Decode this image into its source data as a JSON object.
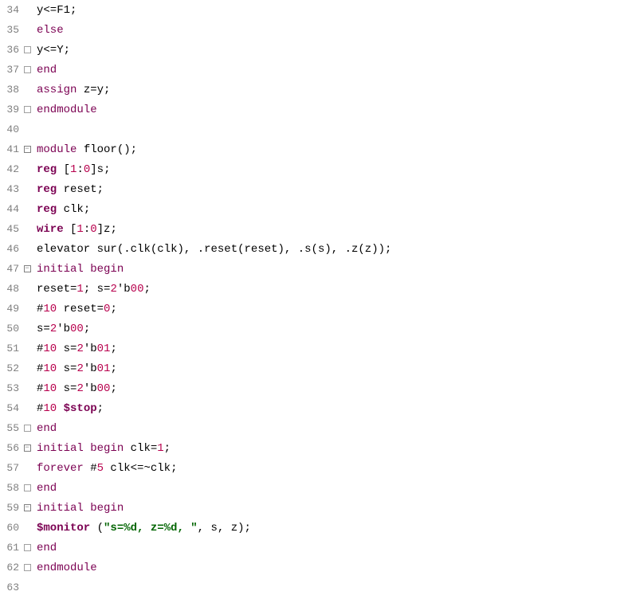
{
  "lines": [
    {
      "n": 34,
      "fold": "line",
      "tokens": [
        [
          "ident",
          "y"
        ],
        [
          "punct",
          "<="
        ],
        [
          "ident",
          "F1"
        ],
        [
          "punct",
          ";"
        ]
      ]
    },
    {
      "n": 35,
      "fold": "line",
      "tokens": [
        [
          "kw2",
          "else"
        ]
      ]
    },
    {
      "n": 36,
      "fold": "end",
      "tokens": [
        [
          "ident",
          "y"
        ],
        [
          "punct",
          "<="
        ],
        [
          "ident",
          "Y"
        ],
        [
          "punct",
          ";"
        ]
      ]
    },
    {
      "n": 37,
      "fold": "end",
      "tokens": [
        [
          "kw2",
          "end"
        ]
      ]
    },
    {
      "n": 38,
      "fold": "line",
      "tokens": [
        [
          "kw2",
          "assign"
        ],
        [
          "ident",
          " z"
        ],
        [
          "punct",
          "="
        ],
        [
          "ident",
          "y"
        ],
        [
          "punct",
          ";"
        ]
      ]
    },
    {
      "n": 39,
      "fold": "end",
      "tokens": [
        [
          "kw2",
          "endmodule"
        ]
      ]
    },
    {
      "n": 40,
      "fold": "line",
      "tokens": []
    },
    {
      "n": 41,
      "fold": "open",
      "tokens": [
        [
          "kw2",
          "module"
        ],
        [
          "ident",
          " floor"
        ],
        [
          "punct",
          "();"
        ]
      ]
    },
    {
      "n": 42,
      "fold": "line",
      "tokens": [
        [
          "kw",
          "reg"
        ],
        [
          "punct",
          " ["
        ],
        [
          "num",
          "1"
        ],
        [
          "punct",
          ":"
        ],
        [
          "num",
          "0"
        ],
        [
          "punct",
          "]"
        ],
        [
          "ident",
          "s"
        ],
        [
          "punct",
          ";"
        ]
      ]
    },
    {
      "n": 43,
      "fold": "line",
      "tokens": [
        [
          "kw",
          "reg"
        ],
        [
          "ident",
          " reset"
        ],
        [
          "punct",
          ";"
        ]
      ]
    },
    {
      "n": 44,
      "fold": "line",
      "tokens": [
        [
          "kw",
          "reg"
        ],
        [
          "ident",
          " clk"
        ],
        [
          "punct",
          ";"
        ]
      ]
    },
    {
      "n": 45,
      "fold": "line",
      "tokens": [
        [
          "kw",
          "wire"
        ],
        [
          "punct",
          " ["
        ],
        [
          "num",
          "1"
        ],
        [
          "punct",
          ":"
        ],
        [
          "num",
          "0"
        ],
        [
          "punct",
          "]"
        ],
        [
          "ident",
          "z"
        ],
        [
          "punct",
          ";"
        ]
      ]
    },
    {
      "n": 46,
      "fold": "line",
      "tokens": [
        [
          "ident",
          "elevator sur"
        ],
        [
          "punct",
          "(."
        ],
        [
          "ident",
          "clk"
        ],
        [
          "punct",
          "("
        ],
        [
          "ident",
          "clk"
        ],
        [
          "punct",
          "), ."
        ],
        [
          "ident",
          "reset"
        ],
        [
          "punct",
          "("
        ],
        [
          "ident",
          "reset"
        ],
        [
          "punct",
          "), ."
        ],
        [
          "ident",
          "s"
        ],
        [
          "punct",
          "("
        ],
        [
          "ident",
          "s"
        ],
        [
          "punct",
          "), ."
        ],
        [
          "ident",
          "z"
        ],
        [
          "punct",
          "("
        ],
        [
          "ident",
          "z"
        ],
        [
          "punct",
          "));"
        ]
      ]
    },
    {
      "n": 47,
      "fold": "open",
      "tokens": [
        [
          "kw2",
          "initial"
        ],
        [
          "ident",
          " "
        ],
        [
          "kw2",
          "begin"
        ]
      ]
    },
    {
      "n": 48,
      "fold": "line",
      "tokens": [
        [
          "ident",
          "reset"
        ],
        [
          "punct",
          "="
        ],
        [
          "num",
          "1"
        ],
        [
          "punct",
          "; "
        ],
        [
          "ident",
          "s"
        ],
        [
          "punct",
          "="
        ],
        [
          "num",
          "2"
        ],
        [
          "punct",
          "'b"
        ],
        [
          "num",
          "00"
        ],
        [
          "punct",
          ";"
        ]
      ]
    },
    {
      "n": 49,
      "fold": "line",
      "tokens": [
        [
          "punct",
          "#"
        ],
        [
          "num",
          "10"
        ],
        [
          "ident",
          " reset"
        ],
        [
          "punct",
          "="
        ],
        [
          "num",
          "0"
        ],
        [
          "punct",
          ";"
        ]
      ]
    },
    {
      "n": 50,
      "fold": "line",
      "tokens": [
        [
          "ident",
          "s"
        ],
        [
          "punct",
          "="
        ],
        [
          "num",
          "2"
        ],
        [
          "punct",
          "'b"
        ],
        [
          "num",
          "00"
        ],
        [
          "punct",
          ";"
        ]
      ]
    },
    {
      "n": 51,
      "fold": "line",
      "tokens": [
        [
          "punct",
          "#"
        ],
        [
          "num",
          "10"
        ],
        [
          "ident",
          " s"
        ],
        [
          "punct",
          "="
        ],
        [
          "num",
          "2"
        ],
        [
          "punct",
          "'b"
        ],
        [
          "num",
          "01"
        ],
        [
          "punct",
          ";"
        ]
      ]
    },
    {
      "n": 52,
      "fold": "line",
      "tokens": [
        [
          "punct",
          "#"
        ],
        [
          "num",
          "10"
        ],
        [
          "ident",
          " s"
        ],
        [
          "punct",
          "="
        ],
        [
          "num",
          "2"
        ],
        [
          "punct",
          "'b"
        ],
        [
          "num",
          "01"
        ],
        [
          "punct",
          ";"
        ]
      ]
    },
    {
      "n": 53,
      "fold": "line",
      "tokens": [
        [
          "punct",
          "#"
        ],
        [
          "num",
          "10"
        ],
        [
          "ident",
          " s"
        ],
        [
          "punct",
          "="
        ],
        [
          "num",
          "2"
        ],
        [
          "punct",
          "'b"
        ],
        [
          "num",
          "00"
        ],
        [
          "punct",
          ";"
        ]
      ]
    },
    {
      "n": 54,
      "fold": "line",
      "tokens": [
        [
          "punct",
          "#"
        ],
        [
          "num",
          "10"
        ],
        [
          "ident",
          " "
        ],
        [
          "sys",
          "$stop"
        ],
        [
          "punct",
          ";"
        ]
      ]
    },
    {
      "n": 55,
      "fold": "end",
      "tokens": [
        [
          "kw2",
          "end"
        ]
      ]
    },
    {
      "n": 56,
      "fold": "open",
      "tokens": [
        [
          "kw2",
          "initial"
        ],
        [
          "ident",
          " "
        ],
        [
          "kw2",
          "begin"
        ],
        [
          "ident",
          " clk"
        ],
        [
          "punct",
          "="
        ],
        [
          "num",
          "1"
        ],
        [
          "punct",
          ";"
        ]
      ]
    },
    {
      "n": 57,
      "fold": "line",
      "tokens": [
        [
          "kw2",
          "forever"
        ],
        [
          "punct",
          " #"
        ],
        [
          "num",
          "5"
        ],
        [
          "ident",
          " clk"
        ],
        [
          "punct",
          "<=~"
        ],
        [
          "ident",
          "clk"
        ],
        [
          "punct",
          ";"
        ]
      ]
    },
    {
      "n": 58,
      "fold": "end",
      "tokens": [
        [
          "kw2",
          "end"
        ]
      ]
    },
    {
      "n": 59,
      "fold": "open",
      "tokens": [
        [
          "kw2",
          "initial"
        ],
        [
          "ident",
          " "
        ],
        [
          "kw2",
          "begin"
        ]
      ]
    },
    {
      "n": 60,
      "fold": "line",
      "tokens": [
        [
          "sys",
          "$monitor"
        ],
        [
          "punct",
          " ("
        ],
        [
          "str",
          "\"s=%d, z=%d, \""
        ],
        [
          "punct",
          ", "
        ],
        [
          "ident",
          "s"
        ],
        [
          "punct",
          ", "
        ],
        [
          "ident",
          "z"
        ],
        [
          "punct",
          ");"
        ]
      ]
    },
    {
      "n": 61,
      "fold": "end",
      "tokens": [
        [
          "kw2",
          "end"
        ]
      ]
    },
    {
      "n": 62,
      "fold": "end",
      "tokens": [
        [
          "kw2",
          "endmodule"
        ]
      ]
    },
    {
      "n": 63,
      "fold": "line",
      "tokens": []
    }
  ]
}
